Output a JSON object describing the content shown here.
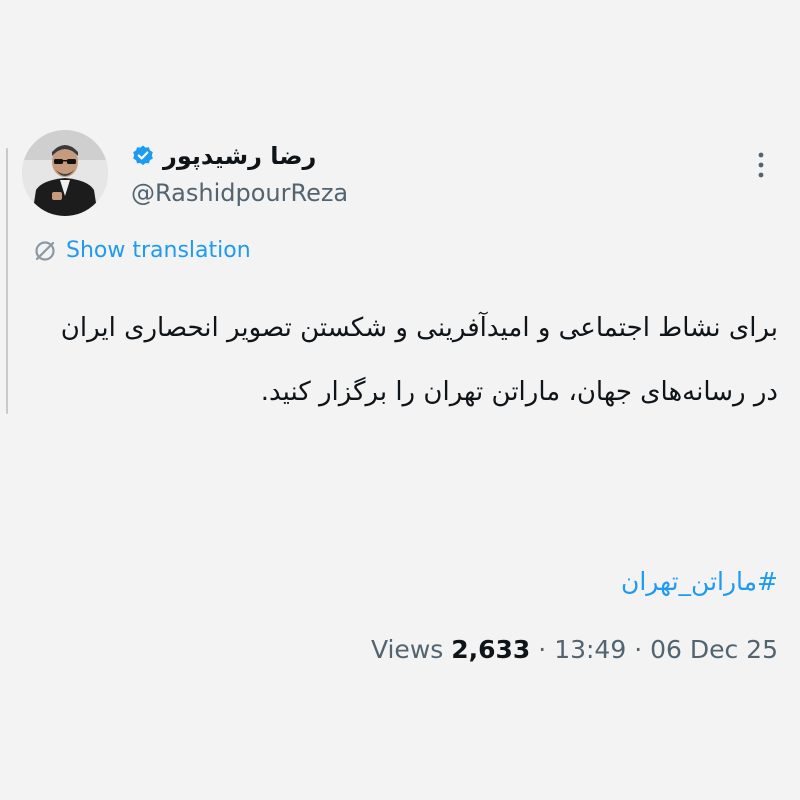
{
  "author": {
    "display_name": "رضا رشیدپور",
    "handle": "@RashidpourReza",
    "verified": true
  },
  "translate": {
    "label": "Show translation"
  },
  "tweet": {
    "text": "برای نشاط اجتماعی و امیدآفرینی و شکستن تصویر انحصاری ایران در رسانه‌های جهان، ماراتن تهران را برگزار کنید.",
    "hashtag": "#ماراتن_تهران"
  },
  "meta": {
    "views_label": "Views",
    "views_count": "2,633",
    "separator": "·",
    "time": "13:49",
    "date": "06 Dec 25"
  },
  "colors": {
    "accent": "#1d9bf0",
    "text_primary": "#0f1419",
    "text_secondary": "#536471",
    "background": "#f3f3f3"
  },
  "icons": {
    "verified": "verified-badge-icon",
    "translate": "translate-icon",
    "more": "more-vertical-icon"
  }
}
